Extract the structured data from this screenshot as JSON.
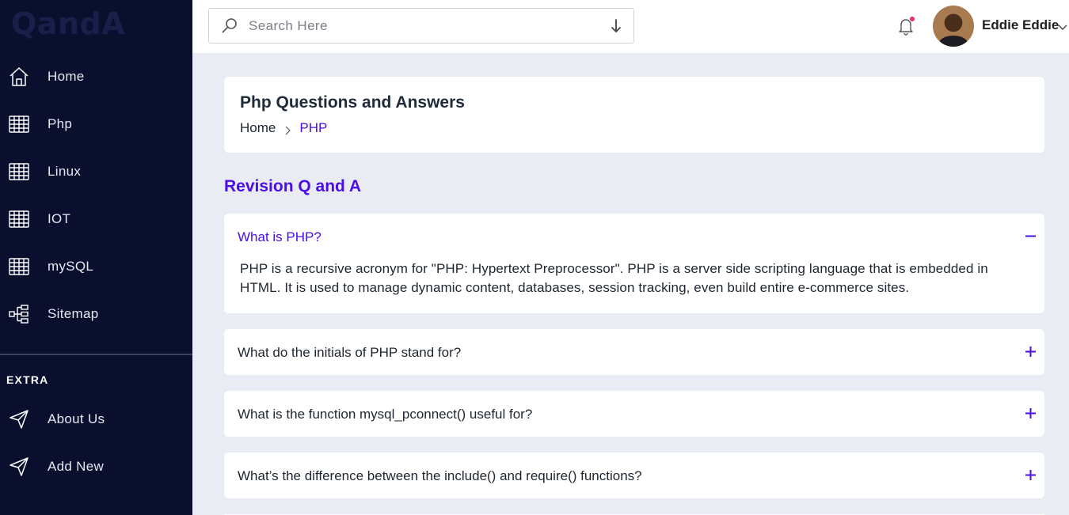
{
  "app": {
    "logo": "QandA"
  },
  "sidebar": {
    "items": [
      {
        "label": "Home",
        "icon": "home-icon"
      },
      {
        "label": "Php",
        "icon": "table-icon"
      },
      {
        "label": "Linux",
        "icon": "table-icon"
      },
      {
        "label": "IOT",
        "icon": "table-icon"
      },
      {
        "label": "mySQL",
        "icon": "table-icon"
      },
      {
        "label": "Sitemap",
        "icon": "sitemap-icon"
      }
    ],
    "extra_title": "EXTRA",
    "extra_items": [
      {
        "label": "About Us",
        "icon": "paper-plane-icon"
      },
      {
        "label": "Add New",
        "icon": "paper-plane-icon"
      }
    ]
  },
  "header": {
    "search_placeholder": "Search Here",
    "user_name": "Eddie Eddie"
  },
  "page": {
    "title": "Php Questions and Answers",
    "breadcrumb": [
      "Home",
      "PHP"
    ],
    "section_heading": "Revision Q and A"
  },
  "faqs": [
    {
      "question": "What is PHP?",
      "expanded": true,
      "answer": "PHP is a recursive acronym for \"PHP: Hypertext Preprocessor\". PHP is a server side scripting language that is embedded in HTML. It is used to manage dynamic content, databases, session tracking, even build entire e-commerce sites."
    },
    {
      "question": "What do the initials of PHP stand for?",
      "expanded": false
    },
    {
      "question": "What is the function mysql_pconnect() useful for?",
      "expanded": false
    },
    {
      "question": "What’s the difference between the include() and require() functions?",
      "expanded": false
    }
  ],
  "colors": {
    "sidebar_bg": "#0b0f2e",
    "accent": "#4a0ee6",
    "notification_dot": "#e6325c",
    "page_bg": "#e9edf3"
  }
}
